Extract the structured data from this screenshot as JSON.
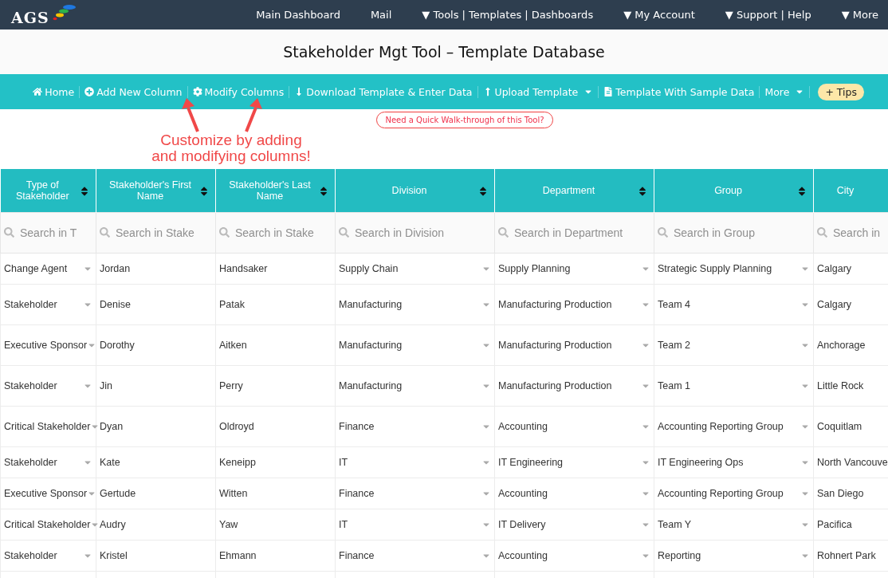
{
  "logo": {
    "text": "AGS"
  },
  "nav": [
    "Main Dashboard",
    "Mail",
    "▼ Tools | Templates | Dashboards",
    "▼ My Account",
    "▼ Support | Help",
    "▼ More"
  ],
  "page_title": "Stakeholder Mgt Tool – Template Database",
  "toolbar": [
    {
      "label": "Home",
      "kind": "home",
      "menu": false
    },
    {
      "label": "Add New Column",
      "kind": "plus",
      "menu": false
    },
    {
      "label": "Modify Columns",
      "kind": "gear",
      "menu": false
    },
    {
      "label": "Download Template & Enter Data",
      "kind": "down",
      "menu": false
    },
    {
      "label": "Upload Template",
      "kind": "up",
      "menu": true
    },
    {
      "label": "Template With Sample Data",
      "kind": "file",
      "menu": false
    },
    {
      "label": "More",
      "kind": "none",
      "menu": true
    }
  ],
  "tips_button": "+ Tips",
  "walkthrough_button": "Need a Quick Walk-through of this Tool?",
  "annotation": "Customize by adding\nand modifying columns!",
  "table": {
    "columns": [
      {
        "label": "Type of Stakeholder",
        "placeholder": "Search in T",
        "sortable": true,
        "dropdown": true
      },
      {
        "label": "Stakeholder's First Name",
        "placeholder": "Search in Stake",
        "sortable": true,
        "dropdown": false
      },
      {
        "label": "Stakeholder's Last Name",
        "placeholder": "Search in Stake",
        "sortable": true,
        "dropdown": false
      },
      {
        "label": "Division",
        "placeholder": "Search in Division",
        "sortable": true,
        "dropdown": true
      },
      {
        "label": "Department",
        "placeholder": "Search in Department",
        "sortable": true,
        "dropdown": true
      },
      {
        "label": "Group",
        "placeholder": "Search in Group",
        "sortable": true,
        "dropdown": true
      },
      {
        "label": "City",
        "placeholder": "Search in",
        "sortable": false,
        "dropdown": false
      }
    ],
    "rows": [
      [
        "Change Agent",
        "Jordan",
        "Handsaker",
        "Supply Chain",
        "Supply Planning",
        "Strategic Supply Planning",
        "Calgary"
      ],
      [
        "Stakeholder",
        "Denise",
        "Patak",
        "Manufacturing",
        "Manufacturing Production",
        "Team 4",
        "Calgary"
      ],
      [
        "Executive Sponsor",
        "Dorothy",
        "Aitken",
        "Manufacturing",
        "Manufacturing Production",
        "Team 2",
        "Anchorage"
      ],
      [
        "Stakeholder",
        "Jin",
        "Perry",
        "Manufacturing",
        "Manufacturing Production",
        "Team 1",
        "Little Rock"
      ],
      [
        "Critical Stakeholder",
        "Dyan",
        "Oldroyd",
        "Finance",
        "Accounting",
        "Accounting Reporting Group",
        "Coquitlam"
      ],
      [
        "Stakeholder",
        "Kate",
        "Keneipp",
        "IT",
        "IT Engineering",
        "IT Engineering Ops",
        "North Vancouve"
      ],
      [
        "Executive Sponsor",
        "Gertude",
        "Witten",
        "Finance",
        "Accounting",
        "Accounting Reporting Group",
        "San Diego"
      ],
      [
        "Critical Stakeholder",
        "Audry",
        "Yaw",
        "IT",
        "IT Delivery",
        "Team Y",
        "Pacifica"
      ],
      [
        "Stakeholder",
        "Kristel",
        "Ehmann",
        "Finance",
        "Accounting",
        "Reporting",
        "Rohnert Park"
      ]
    ]
  }
}
